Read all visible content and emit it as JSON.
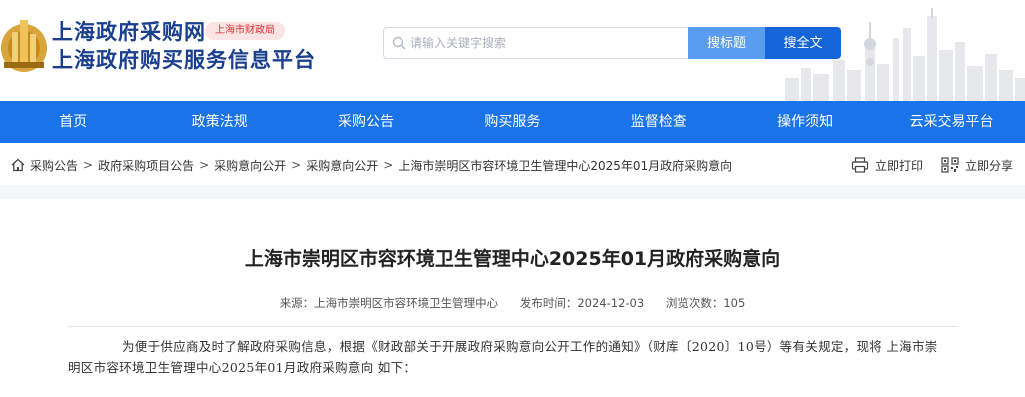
{
  "header": {
    "site_name_line1": "上海政府采购网",
    "badge": "上海市财政局",
    "site_name_line2": "上海政府购买服务信息平台",
    "logo_icon": "shanghai-procurement-logo",
    "search": {
      "placeholder": "请输入关键字搜索",
      "btn_title": "搜标题",
      "btn_full": "搜全文"
    }
  },
  "nav": {
    "items": [
      "首页",
      "政策法规",
      "采购公告",
      "购买服务",
      "监督检查",
      "操作须知",
      "云采交易平台"
    ]
  },
  "breadcrumb": {
    "items": [
      "采购公告",
      "政府采购项目公告",
      "采购意向公开",
      "采购意向公开",
      "上海市崇明区市容环境卫生管理中心2025年01月政府采购意向"
    ],
    "print_label": "立即打印",
    "share_label": "立即分享"
  },
  "article": {
    "title": "上海市崇明区市容环境卫生管理中心2025年01月政府采购意向",
    "source": "来源：上海市崇明区市容环境卫生管理中心",
    "publish_time": "发布时间：2024-12-03",
    "views": "浏览次数：105",
    "paragraph": "为便于供应商及时了解政府采购信息，根据《财政部关于开展政府采购意向公开工作的通知》（财库〔2020〕10号）等有关规定，现将 上海市崇明区市容环境卫生管理中心2025年01月政府采购意向 如下："
  },
  "colors": {
    "brand_blue": "#1a73e8",
    "title_blue": "#1a3f8f",
    "badge_red": "#d43030",
    "button_light": "#5a9cf0",
    "button_dark": "#1565d8"
  }
}
